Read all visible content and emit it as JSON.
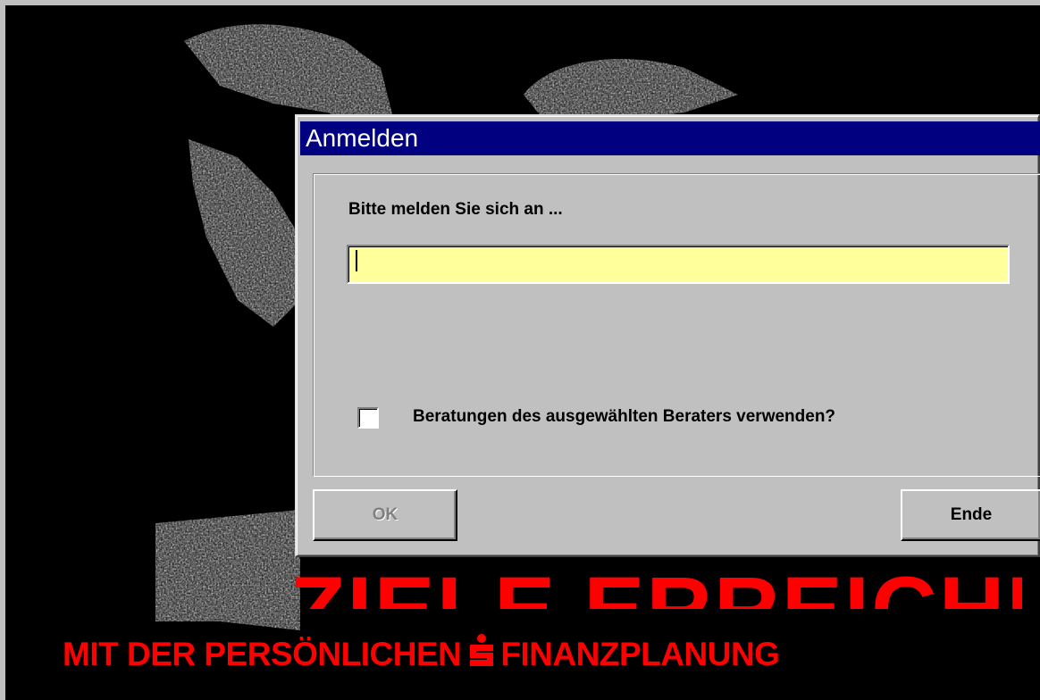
{
  "background": {
    "headline": "ZIELE ERREICHEN",
    "tagline_left": "MIT DER PERSÖNLICHEN",
    "tagline_right": "FINANZPLANUNG",
    "accent_color": "#ff0000",
    "logo_icon": "sparkasse-s-logo"
  },
  "dialog": {
    "title": "Anmelden",
    "prompt": "Bitte melden Sie sich an ...",
    "login_value": "",
    "checkbox_label": "Beratungen des ausgewählten Beraters verwenden?",
    "checkbox_checked": false,
    "ok_label": "OK",
    "ok_enabled": false,
    "end_label": "Ende",
    "titlebar_color": "#000080",
    "input_color": "#ffff9c"
  }
}
